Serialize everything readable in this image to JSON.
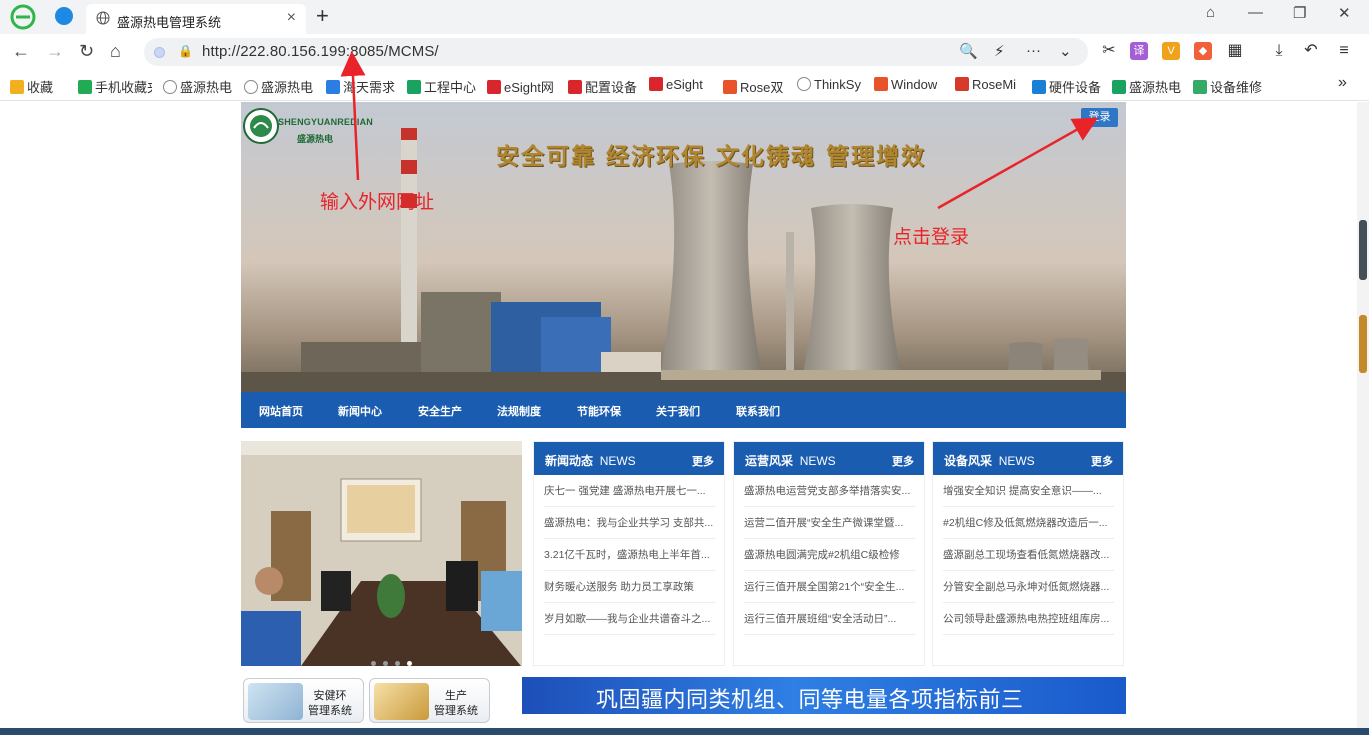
{
  "browser": {
    "tab_title": "盛源热电管理系统",
    "tab_close": "×",
    "new_tab": "+",
    "address": "http://222.80.156.199:8085/MCMS/",
    "nav": {
      "back": "←",
      "forward": "→",
      "refresh": "↻",
      "home": "⌂"
    },
    "address_actions": {
      "search": "🔍",
      "boost": "⚡",
      "more": "···",
      "expand": "⌄"
    },
    "tools": [
      {
        "name": "cut-icon",
        "glyph": "✂"
      },
      {
        "name": "translate-icon",
        "glyph": "译",
        "color": "#a45fd6"
      },
      {
        "name": "shield-icon",
        "glyph": "V",
        "color": "#f0a21c"
      },
      {
        "name": "game-icon",
        "glyph": "◆",
        "color": "#f0603a"
      },
      {
        "name": "apps-icon",
        "glyph": "▦"
      },
      {
        "name": "download-icon",
        "glyph": "⤓"
      },
      {
        "name": "undo-icon",
        "glyph": "↶"
      },
      {
        "name": "menu-icon",
        "glyph": "≡"
      }
    ],
    "window": {
      "pin": "⌂",
      "minimize": "—",
      "maximize": "❐",
      "close": "✕"
    }
  },
  "bookmarks": [
    {
      "label": "收藏",
      "icon": "star-icon",
      "color": "#f2b01e"
    },
    {
      "label": "手机收藏夹",
      "icon": "phone-icon",
      "color": "#22aa55"
    },
    {
      "label": "盛源热电",
      "icon": "globe-icon",
      "color": "#888888"
    },
    {
      "label": "盛源热电",
      "icon": "globe-icon",
      "color": "#888888"
    },
    {
      "label": "海天需求",
      "icon": "g-icon",
      "color": "#2a7de1"
    },
    {
      "label": "工程中心",
      "icon": "sheet-icon",
      "color": "#1aa260"
    },
    {
      "label": "eSight网",
      "icon": "huawei-icon",
      "color": "#d8262c"
    },
    {
      "label": "配置设备",
      "icon": "huawei-icon",
      "color": "#d8262c"
    },
    {
      "label": "eSight",
      "icon": "huawei-icon",
      "color": "#d8262c"
    },
    {
      "label": "Rose双",
      "icon": "c-icon",
      "color": "#e8532a"
    },
    {
      "label": "ThinkSy",
      "icon": "globe-icon",
      "color": "#888888"
    },
    {
      "label": "Window",
      "icon": "c-icon",
      "color": "#e8532a"
    },
    {
      "label": "RoseMi",
      "icon": "rose-icon",
      "color": "#d83a2a"
    },
    {
      "label": "硬件设备",
      "icon": "person-icon",
      "color": "#1b7fd6"
    },
    {
      "label": "盛源热电",
      "icon": "sheet-icon",
      "color": "#1aa260"
    },
    {
      "label": "设备维修",
      "icon": "o-icon",
      "color": "#33aa66"
    }
  ],
  "bookmarks_more": "»",
  "site": {
    "name_en": "SHENGYUANREDIAN",
    "name_cn": "盛源热电",
    "slogan": "安全可靠 经济环保 文化铸魂 管理增效",
    "login": "登录",
    "nav": [
      "网站首页",
      "新闻中心",
      "安全生产",
      "法规制度",
      "节能环保",
      "关于我们",
      "联系我们"
    ],
    "columns": [
      {
        "title": "新闻动态",
        "title_en": "NEWS",
        "more": "更多",
        "items": [
          "庆七一 强党建 盛源热电开展七一...",
          "盛源热电：我与企业共学习 支部共...",
          "3.21亿千瓦时，盛源热电上半年首...",
          "财务暖心送服务 助力员工享政策",
          "岁月如歌——我与企业共谱奋斗之..."
        ]
      },
      {
        "title": "运营风采",
        "title_en": "NEWS",
        "more": "更多",
        "items": [
          "盛源热电运营党支部多举措落实安...",
          "运营二值开展“安全生产微课堂暨...",
          "盛源热电圆满完成#2机组C级检修",
          "运行三值开展全国第21个“安全生...",
          "运行三值开展班组“安全活动日”..."
        ]
      },
      {
        "title": "设备风采",
        "title_en": "NEWS",
        "more": "更多",
        "items": [
          "增强安全知识 提高安全意识——...",
          "#2机组C修及低氮燃烧器改造后一...",
          "盛源副总工现场查看低氮燃烧器改...",
          "分管安全副总马永坤对低氮燃烧器...",
          "公司领导赴盛源热电热控班组库房..."
        ]
      }
    ],
    "systems": [
      {
        "line1": "安健环",
        "line2": "管理系统"
      },
      {
        "line1": "生产",
        "line2": "管理系统"
      }
    ],
    "strip": "巩固疆内同类机组、同等电量各项指标前三"
  },
  "annotations": {
    "address_hint": "输入外网网址",
    "login_hint": "点击登录",
    "color": "#e8242a"
  }
}
